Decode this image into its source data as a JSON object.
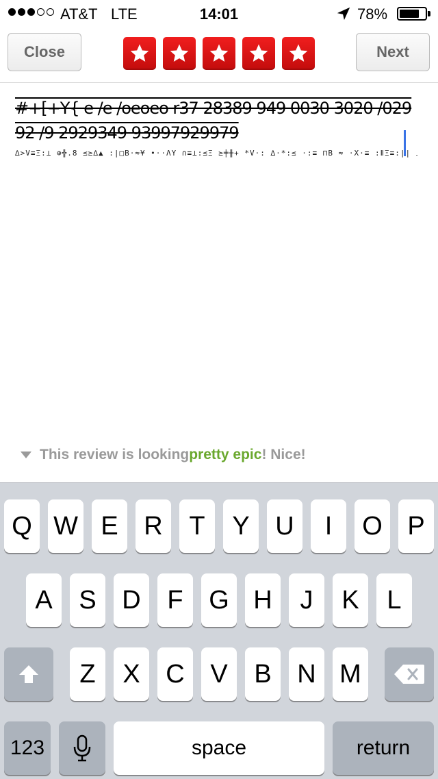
{
  "status_bar": {
    "carrier": "AT&T",
    "network": "LTE",
    "time": "14:01",
    "battery_pct": "78%",
    "battery_level": 0.78,
    "signal_bars_filled": 3,
    "signal_bars_total": 5
  },
  "toolbar": {
    "close_label": "Close",
    "next_label": "Next",
    "rating": 5,
    "rating_max": 5,
    "star_color": "#e3120b"
  },
  "review": {
    "text": "#+[+Y{ e /e /oeoeo r37 28389 949 0030 3020 /02992 /9 2929349 93997929979",
    "noise": "∆>V≡Ξ:⊥  ⊕╬.8 ≤≥∆▲ :|□B·≈¥  •··ΛY  ∩≡⊥:≤Ξ ≥╪╫+  *V·:  ∆·*:≤  ·:≡  ⊓B ≈ ·X·≡ :ⅡΞ≡:||  ⊥∆≤Ξ· +╬:*:≡∆·V :·*·+:≤ ∆|:· ≡:"
  },
  "hint": {
    "prefix": "This review is looking ",
    "highlight": "pretty epic",
    "suffix": "! Nice!",
    "highlight_color": "#6aa82e"
  },
  "keyboard": {
    "row1": [
      "Q",
      "W",
      "E",
      "R",
      "T",
      "Y",
      "U",
      "I",
      "O",
      "P"
    ],
    "row2": [
      "A",
      "S",
      "D",
      "F",
      "G",
      "H",
      "J",
      "K",
      "L"
    ],
    "row3": [
      "Z",
      "X",
      "C",
      "V",
      "B",
      "N",
      "M"
    ],
    "numbers_label": "123",
    "space_label": "space",
    "return_label": "return"
  }
}
